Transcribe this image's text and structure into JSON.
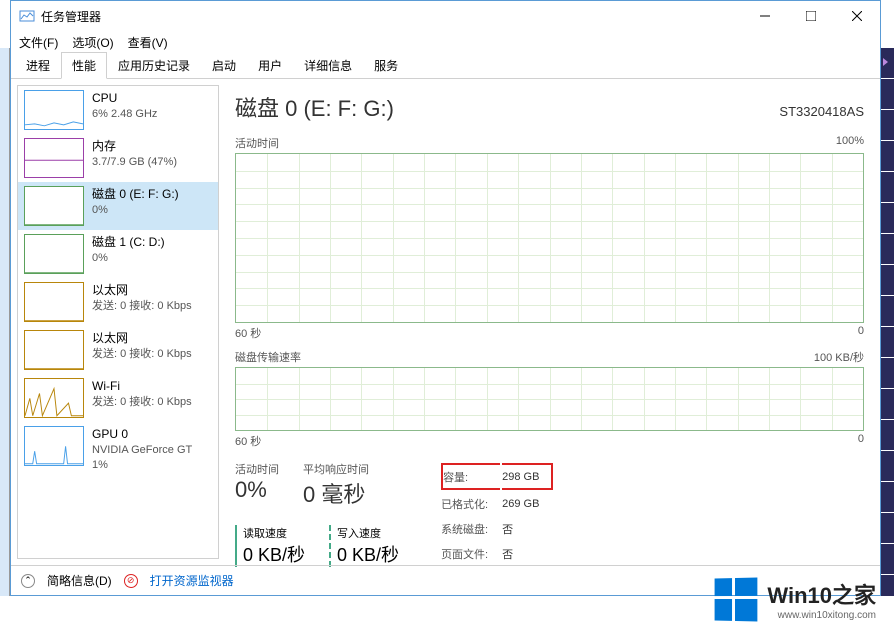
{
  "window": {
    "title": "任务管理器",
    "controls": {
      "min": "minimize",
      "max": "maximize",
      "close": "close"
    }
  },
  "menu": {
    "file": "文件(F)",
    "options": "选项(O)",
    "view": "查看(V)"
  },
  "tabs": {
    "processes": "进程",
    "performance": "性能",
    "app_history": "应用历史记录",
    "startup": "启动",
    "users": "用户",
    "details": "详细信息",
    "services": "服务"
  },
  "sidebar": [
    {
      "title": "CPU",
      "sub": "6% 2.48 GHz",
      "color": "#4aa0e8"
    },
    {
      "title": "内存",
      "sub": "3.7/7.9 GB (47%)",
      "color": "#9b3fa8"
    },
    {
      "title": "磁盘 0 (E: F: G:)",
      "sub": "0%",
      "color": "#5aa05a",
      "selected": true
    },
    {
      "title": "磁盘 1 (C: D:)",
      "sub": "0%",
      "color": "#5aa05a"
    },
    {
      "title": "以太网",
      "sub": "发送: 0 接收: 0 Kbps",
      "color": "#b8860b"
    },
    {
      "title": "以太网",
      "sub": "发送: 0 接收: 0 Kbps",
      "color": "#b8860b"
    },
    {
      "title": "Wi-Fi",
      "sub": "发送: 0 接收: 0 Kbps",
      "color": "#b8860b"
    },
    {
      "title": "GPU 0",
      "sub": "NVIDIA GeForce GT",
      "sub2": "1%",
      "color": "#4aa0e8"
    }
  ],
  "main": {
    "title": "磁盘 0 (E: F: G:)",
    "model": "ST3320418AS",
    "chart1": {
      "label": "活动时间",
      "max": "100%",
      "xmin": "60 秒",
      "xmax": "0"
    },
    "chart2": {
      "label": "磁盘传输速率",
      "max": "100 KB/秒",
      "xmin": "60 秒",
      "xmax": "0"
    },
    "stats": {
      "active_label": "活动时间",
      "active_value": "0%",
      "response_label": "平均响应时间",
      "response_value": "0 毫秒",
      "read_label": "读取速度",
      "read_value": "0 KB/秒",
      "write_label": "写入速度",
      "write_value": "0 KB/秒"
    },
    "info": {
      "capacity_label": "容量:",
      "capacity_value": "298 GB",
      "formatted_label": "已格式化:",
      "formatted_value": "269 GB",
      "system_label": "系统磁盘:",
      "system_value": "否",
      "pagefile_label": "页面文件:",
      "pagefile_value": "否"
    }
  },
  "statusbar": {
    "fewer": "简略信息(D)",
    "resmon": "打开资源监视器"
  },
  "watermark": {
    "text": "Win10之家",
    "url": "www.win10xitong.com"
  },
  "chart_data": [
    {
      "type": "line",
      "title": "活动时间",
      "ylabel": "%",
      "ylim": [
        0,
        100
      ],
      "x_range_seconds": [
        60,
        0
      ],
      "values": [
        0,
        0,
        0,
        0,
        0,
        0,
        0,
        0,
        0,
        0
      ]
    },
    {
      "type": "line",
      "title": "磁盘传输速率",
      "ylabel": "KB/秒",
      "ylim": [
        0,
        100
      ],
      "x_range_seconds": [
        60,
        0
      ],
      "values": [
        0,
        0,
        0,
        0,
        0,
        0,
        0,
        0,
        0,
        0
      ]
    }
  ]
}
